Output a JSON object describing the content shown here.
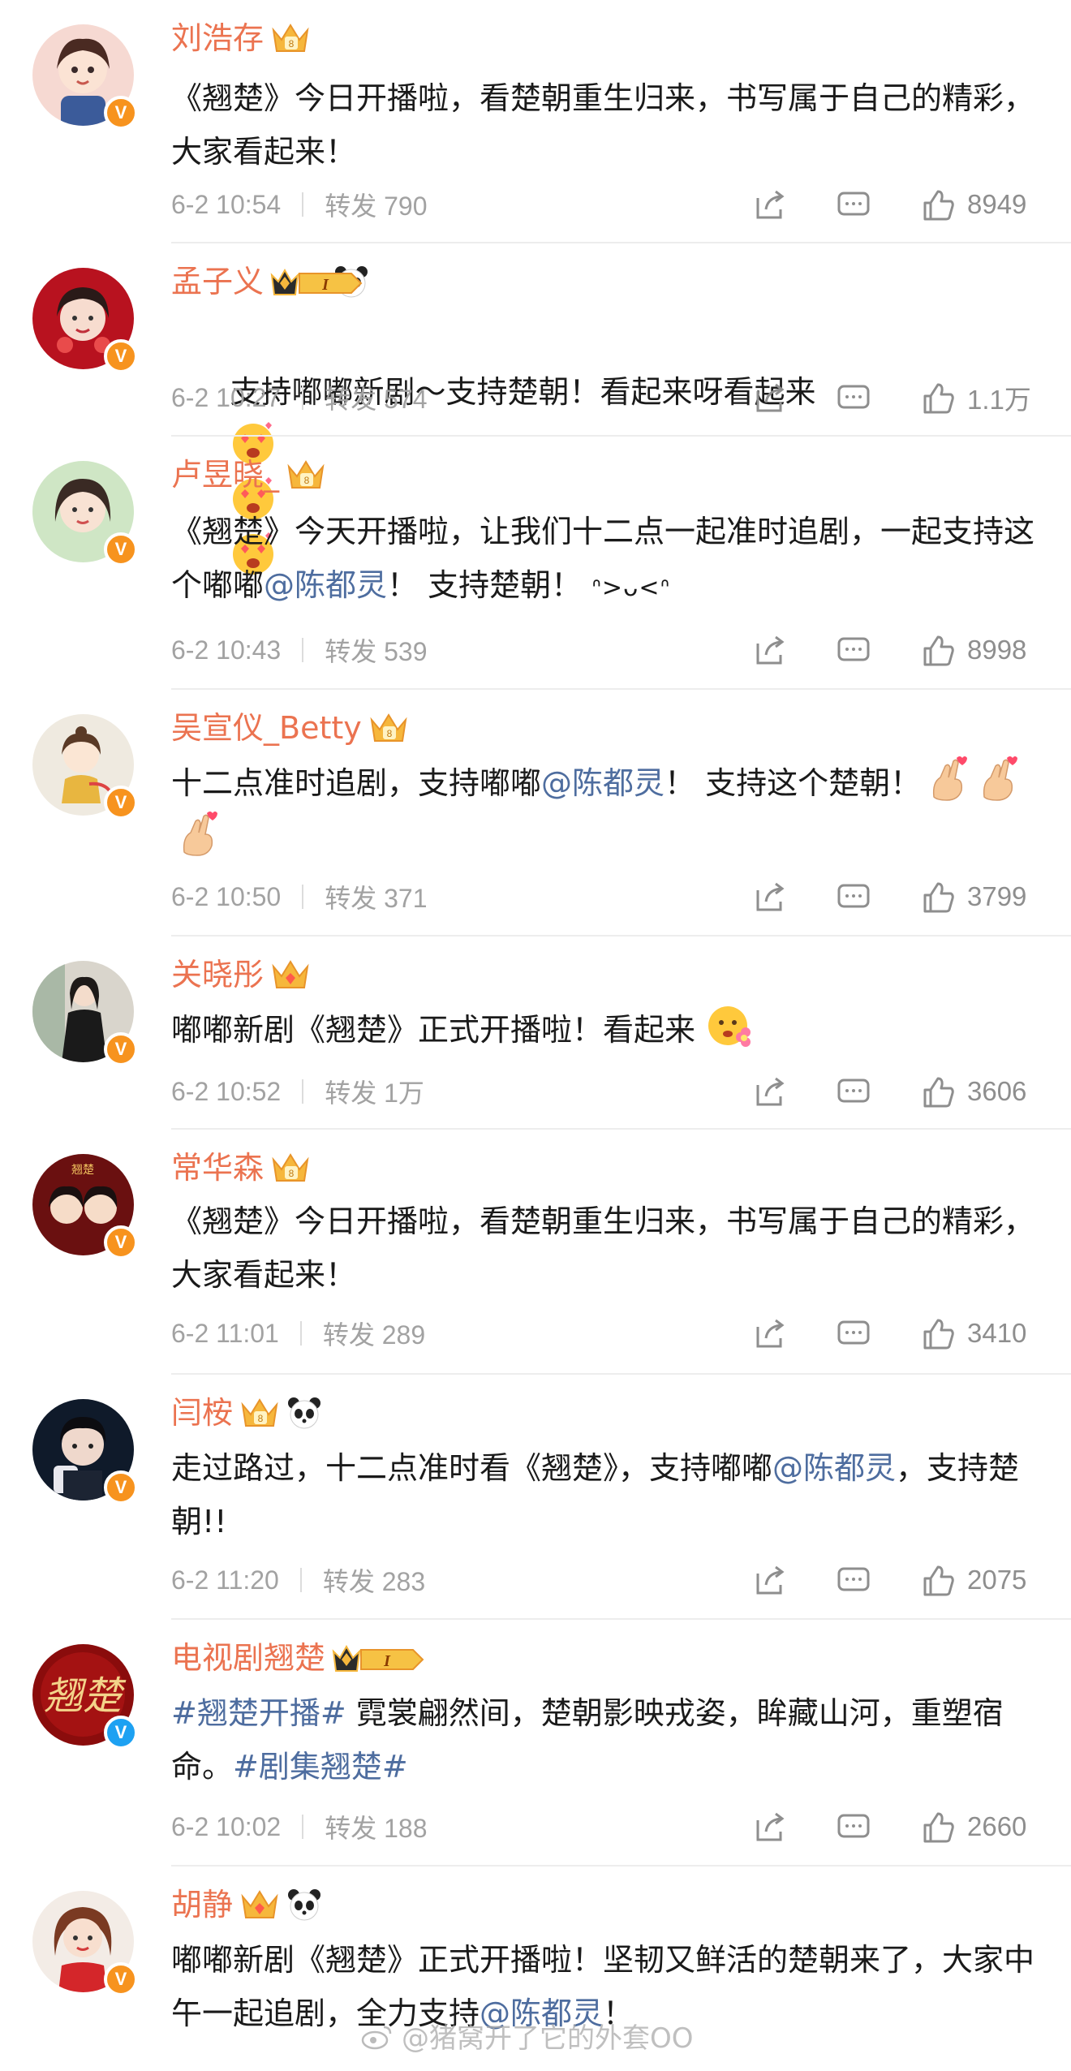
{
  "colors": {
    "name": "#eb7350",
    "link": "#4e6d9f",
    "meta": "#a2a2a2",
    "verified_orange": "#f7931e",
    "verified_blue": "#1da1f2"
  },
  "posts": [
    {
      "name": "刘浩存",
      "content": "《翘楚》今日开播啦，看楚朝重生归来，书写属于自己的精彩，大家看起来！",
      "time": "6-2 10:54",
      "repost": "转发 790",
      "likes": "8949"
    },
    {
      "name": "孟子义",
      "content": "支持嘟嘟新剧～支持楚朝！看起来呀看起来",
      "time": "6-2 10:27",
      "repost": "转发 574",
      "likes": "1.1万",
      "level": "I"
    },
    {
      "name": "卢昱晓_",
      "content_a": "《翘楚》今天开播啦，让我们十二点一起准时追剧，一起支持这个嘟嘟",
      "mention": "@陈都灵",
      "content_b": "！ 支持楚朝！",
      "kaomoji": "ᐢ>ᴗ<ᐢ",
      "time": "6-2 10:43",
      "repost": "转发 539",
      "likes": "8998"
    },
    {
      "name": "吴宣仪_Betty",
      "content_a": "十二点准时追剧，支持嘟嘟",
      "mention": "@陈都灵",
      "content_b": "！ 支持这个楚朝！",
      "time": "6-2 10:50",
      "repost": "转发 371",
      "likes": "3799"
    },
    {
      "name": "关晓彤",
      "content": "嘟嘟新剧《翘楚》正式开播啦！看起来",
      "time": "6-2 10:52",
      "repost": "转发 1万",
      "likes": "3606"
    },
    {
      "name": "常华森",
      "content": "《翘楚》今日开播啦，看楚朝重生归来，书写属于自己的精彩，大家看起来！",
      "time": "6-2 11:01",
      "repost": "转发 289",
      "likes": "3410"
    },
    {
      "name": "闫桉",
      "content_a": "走过路过，十二点准时看《翘楚》，支持嘟嘟",
      "mention": "@陈都灵",
      "content_b": "，支持楚朝!!",
      "time": "6-2 11:20",
      "repost": "转发 283",
      "likes": "2075"
    },
    {
      "name": "电视剧翘楚",
      "tag_a": "#翘楚开播#",
      "content_a": " 霓裳翩然间，楚朝影映戎姿，眸藏山河，重塑宿命。",
      "tag_b": "#剧集翘楚#",
      "time": "6-2 10:02",
      "repost": "转发 188",
      "likes": "2660",
      "level": "I"
    },
    {
      "name": "胡静",
      "content_a": "嘟嘟新剧《翘楚》正式开播啦！坚韧又鲜活的楚朝来了，大家中午一起追剧，全力支持",
      "mention": "@陈都灵",
      "content_b": "！"
    }
  ],
  "watermark": "@猪窝开了它的外套OO"
}
